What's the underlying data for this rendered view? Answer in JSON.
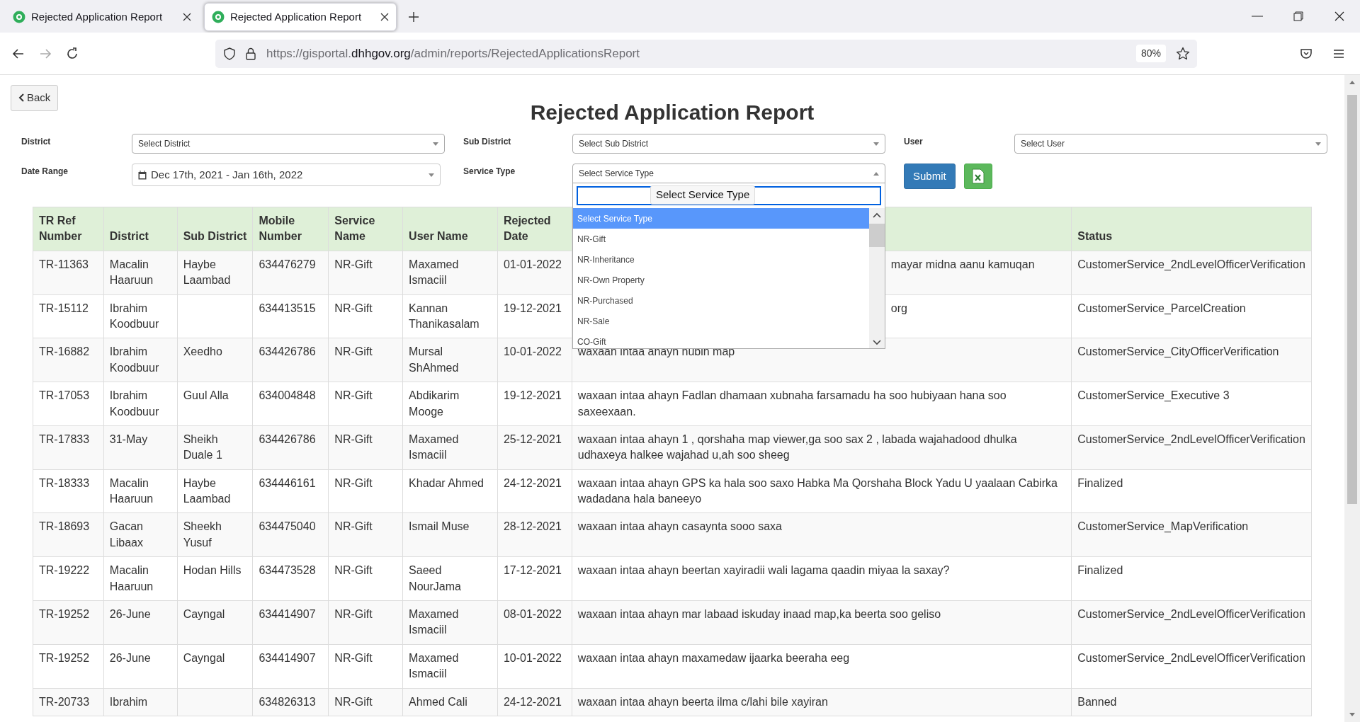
{
  "browser": {
    "tabs": [
      {
        "title": "Rejected Application Report",
        "selected": false
      },
      {
        "title": "Rejected Application Report",
        "selected": true
      }
    ],
    "url": {
      "host_start": "https://gisportal.",
      "domain": "dhhgov.org",
      "path": "/admin/reports/RejectedApplicationsReport"
    },
    "zoom": "80%"
  },
  "page": {
    "back_button": "Back",
    "title": "Rejected Application Report",
    "filters": [
      {
        "kind": "select",
        "label": "District",
        "value": "Select District",
        "open": false
      },
      {
        "kind": "select",
        "label": "Sub District",
        "value": "Select Sub District",
        "open": false
      },
      {
        "kind": "select",
        "label": "User",
        "value": "Select User",
        "open": false
      },
      {
        "kind": "daterange",
        "label": "Date Range",
        "value": "Dec 17th, 2021 - Jan 16th, 2022",
        "open": false
      },
      {
        "kind": "select",
        "label": "Service Type",
        "value": "Select Service Type",
        "open": true
      }
    ],
    "submit_button": "Submit",
    "dropdown": {
      "search_tooltip": "Select Service Type",
      "options": [
        {
          "label": "Select Service Type",
          "selected": true
        },
        {
          "label": "NR-Gift",
          "selected": false
        },
        {
          "label": "NR-Inheritance",
          "selected": false
        },
        {
          "label": "NR-Own Property",
          "selected": false
        },
        {
          "label": "NR-Purchased",
          "selected": false
        },
        {
          "label": "NR-Sale",
          "selected": false
        },
        {
          "label": "CO-Gift",
          "selected": false
        }
      ]
    },
    "table": {
      "columns": [
        {
          "label": "TR Ref Number"
        },
        {
          "label": "District"
        },
        {
          "label": "Sub District"
        },
        {
          "label": "Mobile Number"
        },
        {
          "label": "Service Name"
        },
        {
          "label": "User Name"
        },
        {
          "label": "Rejected Date"
        },
        {},
        {
          "label": "Status"
        }
      ],
      "rows": [
        {
          "cells": [
            "TR-11363",
            "Macalin Haaruun",
            "Haybe Laambad",
            "634476279",
            "NR-Gift",
            "Maxamed Ismaciil",
            "01-01-2022",
            "mayar midna aanu kamuqan",
            "CustomerService_2ndLevelOfficerVerification"
          ],
          "covered": true
        },
        {
          "cells": [
            "TR-15112",
            "Ibrahim Koodbuur",
            "",
            "634413515",
            "NR-Gift",
            "Kannan Thanikasalam",
            "19-12-2021",
            "org",
            "CustomerService_ParcelCreation"
          ],
          "covered": true
        },
        {
          "cells": [
            "TR-16882",
            "Ibrahim Koodbuur",
            "Xeedho",
            "634426786",
            "NR-Gift",
            "Mursal ShAhmed",
            "10-01-2022",
            "waxaan intaa ahayn hubin map",
            "CustomerService_CityOfficerVerification"
          ],
          "covered": false
        },
        {
          "cells": [
            "TR-17053",
            "Ibrahim Koodbuur",
            "Guul Alla",
            "634004848",
            "NR-Gift",
            "Abdikarim Mooge",
            "19-12-2021",
            "waxaan intaa ahayn Fadlan dhamaan xubnaha farsamadu ha soo hubiyaan hana soo saxeexaan.",
            "CustomerService_Executive 3"
          ],
          "covered": false
        },
        {
          "cells": [
            "TR-17833",
            "31-May",
            "Sheikh Duale 1",
            "634426786",
            "NR-Gift",
            "Maxamed Ismaciil",
            "25-12-2021",
            "waxaan intaa ahayn 1 , qorshaha map viewer,ga soo sax 2 , labada wajahadood dhulka udhaxeya halkee wajahad u,ah soo sheeg",
            "CustomerService_2ndLevelOfficerVerification"
          ],
          "covered": false
        },
        {
          "cells": [
            "TR-18333",
            "Macalin Haaruun",
            "Haybe Laambad",
            "634446161",
            "NR-Gift",
            "Khadar Ahmed",
            "24-12-2021",
            "waxaan intaa ahayn GPS ka hala soo saxo Habka Ma Qorshaha Block Yadu U yaalaan Cabirka wadadana hala baneeyo",
            "Finalized"
          ],
          "covered": false
        },
        {
          "cells": [
            "TR-18693",
            "Gacan Libaax",
            "Sheekh Yusuf",
            "634475040",
            "NR-Gift",
            "Ismail Muse",
            "28-12-2021",
            "waxaan intaa ahayn casaynta sooo saxa",
            "CustomerService_MapVerification"
          ],
          "covered": false
        },
        {
          "cells": [
            "TR-19222",
            "Macalin Haaruun",
            "Hodan Hills",
            "634473528",
            "NR-Gift",
            "Saeed NourJama",
            "17-12-2021",
            "waxaan intaa ahayn beertan xayiradii wali lagama qaadin miyaa la saxay?",
            "Finalized"
          ],
          "covered": false
        },
        {
          "cells": [
            "TR-19252",
            "26-June",
            "Cayngal",
            "634414907",
            "NR-Gift",
            "Maxamed Ismaciil",
            "08-01-2022",
            "waxaan intaa ahayn mar labaad iskuday inaad map,ka beerta soo geliso",
            "CustomerService_2ndLevelOfficerVerification"
          ],
          "covered": false
        },
        {
          "cells": [
            "TR-19252",
            "26-June",
            "Cayngal",
            "634414907",
            "NR-Gift",
            "Maxamed Ismaciil",
            "10-01-2022",
            "waxaan intaa ahayn maxamedaw ijaarka beeraha eeg",
            "CustomerService_2ndLevelOfficerVerification"
          ],
          "covered": false
        },
        {
          "cells": [
            "TR-20733",
            "Ibrahim",
            "",
            "634826313",
            "NR-Gift",
            "Ahmed Cali",
            "24-12-2021",
            "waxaan intaa ahayn beerta ilma c/lahi bile xayiran",
            "Banned"
          ],
          "covered": false
        }
      ]
    }
  }
}
